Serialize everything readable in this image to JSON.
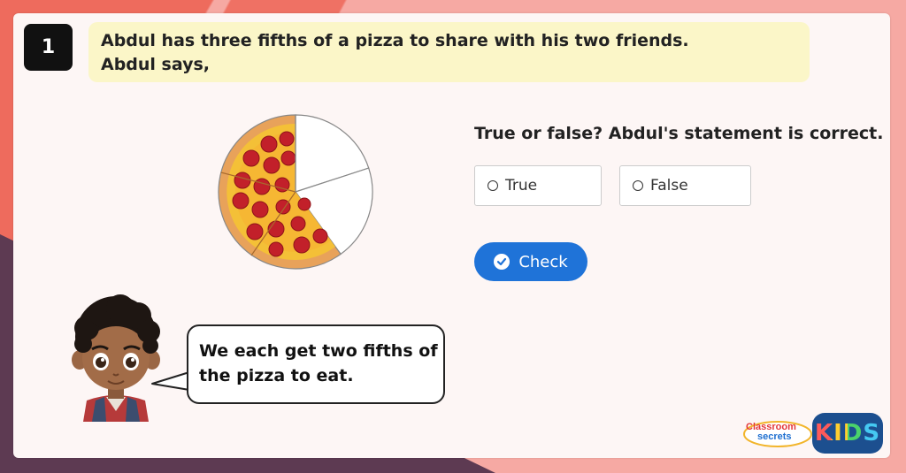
{
  "question": {
    "number": "1",
    "line1": "Abdul has three fifths of a pizza to share with his two friends.",
    "line2": "Abdul says,"
  },
  "statement": "True or false? Abdul's statement is correct.",
  "options": [
    {
      "label": "True"
    },
    {
      "label": "False"
    }
  ],
  "check_label": "Check",
  "speech": {
    "line1": "We each get two fifths of",
    "line2": "the pizza to eat."
  },
  "pizza": {
    "total_slices": 5,
    "filled_slices": 3,
    "empty_slices": 2
  },
  "logo": {
    "brand_line1": "Classroom",
    "brand_line2": "secrets",
    "kids": "KIDS"
  },
  "colors": {
    "accent": "#1f73d8",
    "question_panel": "#fbf6c8",
    "background": "#f6a9a3"
  }
}
